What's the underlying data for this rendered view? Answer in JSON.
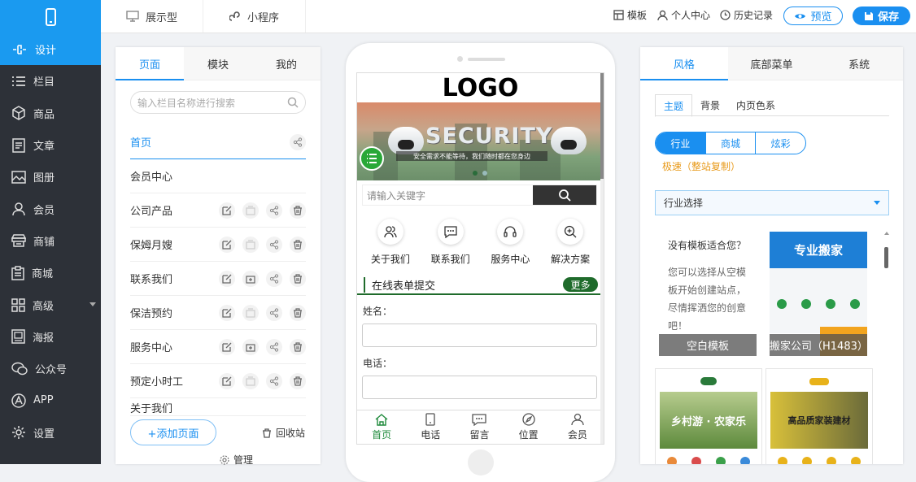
{
  "topbar": {
    "mode_display": "展示型",
    "mode_mini": "小程序",
    "template": "模板",
    "personal": "个人中心",
    "history": "历史记录",
    "preview": "预览",
    "save": "保存"
  },
  "sidebar": {
    "items": [
      {
        "label": "设计",
        "icon": "design-icon"
      },
      {
        "label": "栏目",
        "icon": "list-icon"
      },
      {
        "label": "商品",
        "icon": "box-icon"
      },
      {
        "label": "文章",
        "icon": "article-icon"
      },
      {
        "label": "图册",
        "icon": "image-icon"
      },
      {
        "label": "会员",
        "icon": "user-icon"
      },
      {
        "label": "商铺",
        "icon": "shop-icon"
      },
      {
        "label": "商城",
        "icon": "clipboard-icon"
      },
      {
        "label": "高级",
        "icon": "grid-icon"
      },
      {
        "label": "海报",
        "icon": "poster-icon"
      },
      {
        "label": "公众号",
        "icon": "wechat-icon"
      },
      {
        "label": "APP",
        "icon": "app-icon"
      },
      {
        "label": "设置",
        "icon": "gear-icon"
      }
    ]
  },
  "left_panel": {
    "tabs": [
      "页面",
      "模块",
      "我的"
    ],
    "search_placeholder": "输入栏目名称进行搜索",
    "pages": [
      "首页",
      "会员中心",
      "公司产品",
      "保姆月嫂",
      "联系我们",
      "保洁预约",
      "服务中心",
      "预定小时工",
      "关于我们"
    ],
    "add_page": "+添加页面",
    "recycle": "回收站",
    "manage": "管理"
  },
  "preview": {
    "logo": "LOGO",
    "banner_title": "SECURITY",
    "banner_sub": "安全需求不能等待，我们随时都在您身边",
    "search_placeholder": "请输入关键字",
    "quick_links": [
      "关于我们",
      "联系我们",
      "服务中心",
      "解决方案"
    ],
    "form_title": "在线表单提交",
    "more": "更多",
    "field_name": "姓名：",
    "field_phone": "电话：",
    "bottom_nav": [
      "首页",
      "电话",
      "留言",
      "位置",
      "会员"
    ]
  },
  "right_panel": {
    "tabs": [
      "风格",
      "底部菜单",
      "系统"
    ],
    "subtabs": [
      "主题",
      "背景",
      "内页色系"
    ],
    "segments": [
      "行业",
      "商城",
      "炫彩"
    ],
    "speed_copy": "极速（整站复制）",
    "industry_select": "行业选择",
    "blank_card_title": "没有模板适合您？",
    "blank_card_body": "您可以选择从空模板开始创建站点，尽情挥洒您的创意吧！",
    "blank_caption": "空白模板",
    "template1_caption": "搬家公司（H1483）",
    "template1_banner": "专业搬家",
    "template2_banner": "乡村游 · 农家乐",
    "template3_banner": "高品质家装建材"
  },
  "colors": {
    "brand": "#1a8ff0",
    "sidebar_bg": "#2d3138",
    "preview_accent": "#1f6b2b"
  }
}
